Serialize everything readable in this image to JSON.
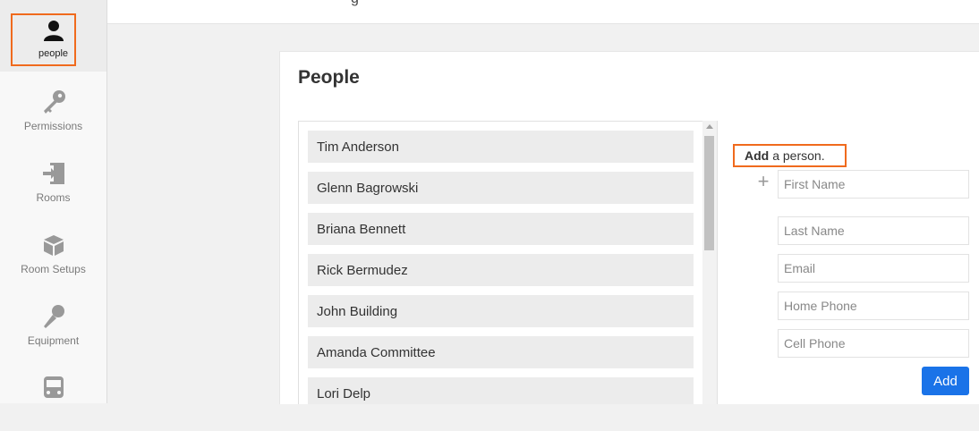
{
  "sidebar": {
    "items": [
      {
        "label": "people",
        "icon": "person-icon",
        "active": true
      },
      {
        "label": "Permissions",
        "icon": "key-icon"
      },
      {
        "label": "Rooms",
        "icon": "door-enter-icon"
      },
      {
        "label": "Room Setups",
        "icon": "cube-icon"
      },
      {
        "label": "Equipment",
        "icon": "microphone-icon"
      },
      {
        "label": "",
        "icon": "bus-icon"
      }
    ]
  },
  "topbar": {
    "fragment": "g"
  },
  "main": {
    "title": "People",
    "people": [
      "Tim Anderson",
      "Glenn Bagrowski",
      "Briana Bennett",
      "Rick Bermudez",
      "John Building",
      "Amanda Committee",
      "Lori Delp"
    ]
  },
  "add_form": {
    "heading_bold": "Add",
    "heading_rest": "a person.",
    "first_name_placeholder": "First Name",
    "last_name_placeholder": "Last Name",
    "email_placeholder": "Email",
    "home_phone_placeholder": "Home Phone",
    "cell_phone_placeholder": "Cell Phone",
    "add_label": "Add"
  },
  "colors": {
    "accent": "#f06a1d",
    "primary_button": "#1a73e8"
  }
}
